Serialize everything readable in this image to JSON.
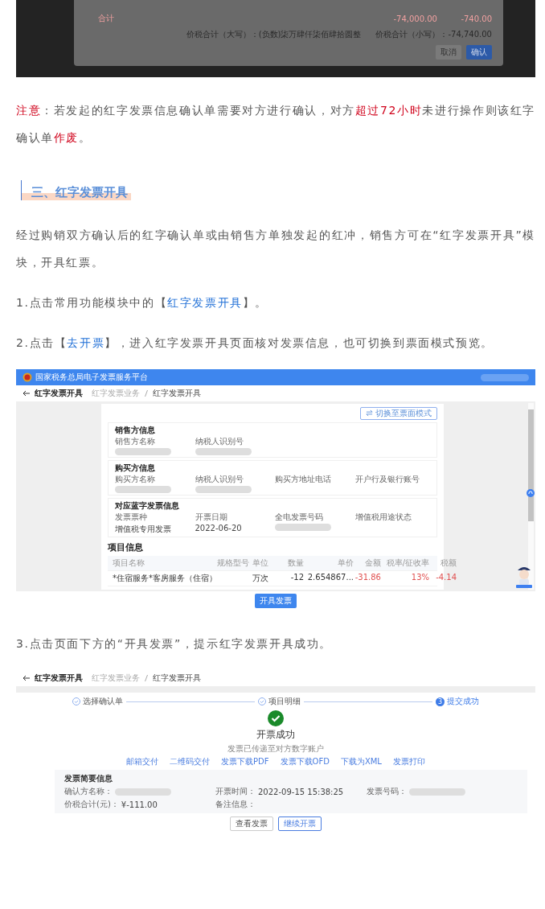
{
  "top_dialog": {
    "total_label": "合计",
    "total_amount": "-74,000.00",
    "total_tax": "-740.00",
    "sum_upper": "价税合计（大写）：(负数)柒万肆仟柒佰肆拾圆整",
    "sum_lower": "价税合计（小写）：-74,740.00",
    "buttons": [
      {
        "label": "取消",
        "primary": false
      },
      {
        "label": "确认",
        "primary": true
      }
    ]
  },
  "note": [
    {
      "text": "注意",
      "kind": "alert"
    },
    {
      "text": "：若发起的红字发票信息确认单需要对方进行确认，对方",
      "kind": "text"
    },
    {
      "text": "超过72小时",
      "kind": "alert"
    },
    {
      "text": "未进行操作则该红字确认单",
      "kind": "text"
    },
    {
      "text": "作废",
      "kind": "alert"
    },
    {
      "text": "。",
      "kind": "text"
    }
  ],
  "section_heading": "三、红字发票开具",
  "intro": "经过购销双方确认后的红字确认单或由销售方单独发起的红冲，销售方可在“红字发票开具”模块，开具红票。",
  "step_1": [
    {
      "text": "1.点击常用功能模块中的【",
      "kind": "text"
    },
    {
      "text": "红字发票开具",
      "kind": "link"
    },
    {
      "text": "】。",
      "kind": "text"
    }
  ],
  "step_2": [
    {
      "text": "2.点击【",
      "kind": "text"
    },
    {
      "text": "去开票",
      "kind": "link"
    },
    {
      "text": "】，进入红字发票开具页面核对发票信息，也可切换到票面模式预览。",
      "kind": "text"
    }
  ],
  "issue_screen": {
    "platform": "国家税务总局电子发票服务平台",
    "page_title": "红字发票开具",
    "breadcrumb": [
      "红字发票业务",
      "红字发票开具"
    ],
    "switch_button": "切换至票面模式",
    "sections": [
      {
        "title": "销售方信息",
        "fields": [
          {
            "label": "销售方名称",
            "blurred": true
          },
          {
            "label": "纳税人识别号",
            "blurred": true
          }
        ]
      },
      {
        "title": "购买方信息",
        "fields": [
          {
            "label": "购买方名称",
            "blurred": true
          },
          {
            "label": "纳税人识别号",
            "blurred": true
          },
          {
            "label": "购买方地址电话",
            "blurred": false
          },
          {
            "label": "开户行及银行账号",
            "blurred": false
          }
        ]
      },
      {
        "title": "对应蓝字发票信息",
        "fields": [
          {
            "label": "发票票种",
            "value": "增值税专用发票"
          },
          {
            "label": "开票日期",
            "value": "2022-06-20"
          },
          {
            "label": "全电发票号码",
            "blurred": true
          },
          {
            "label": "增值税用途状态",
            "blurred": false
          }
        ]
      }
    ],
    "items_title": "项目信息",
    "columns": [
      "项目名称",
      "规格型号",
      "单位",
      "数量",
      "单价",
      "金额",
      "税率/征收率",
      "税额"
    ],
    "rows": [
      [
        {
          "text": "*住宿服务*客房服务（住宿）",
          "negative": false
        },
        null,
        {
          "text": "万次",
          "negative": false
        },
        {
          "text": "-12",
          "negative": false
        },
        {
          "text": "2.654867...",
          "negative": false
        },
        {
          "text": "-31.86",
          "negative": true
        },
        {
          "text": "13%",
          "negative": true
        },
        {
          "text": "-4.14",
          "negative": true
        }
      ]
    ],
    "submit_button": "开具发票"
  },
  "step_3": "3.点击页面下方的“开具发票”，提示红字发票开具成功。",
  "success_screen": {
    "page_title": "红字发票开具",
    "breadcrumb": [
      "红字发票业务",
      "红字发票开具"
    ],
    "progress": [
      {
        "label": "选择确认单",
        "done": true
      },
      {
        "label": "项目明细",
        "done": true
      },
      {
        "label": "提交成功",
        "number": "3",
        "done": false
      }
    ],
    "title": "开票成功",
    "subtitle": "发票已传递至对方数字账户",
    "actions": [
      "邮箱交付",
      "二维码交付",
      "发票下载PDF",
      "发票下载OFD",
      "下载为XML",
      "发票打印"
    ],
    "summary": {
      "title": "发票简要信息",
      "fields": [
        {
          "label": "确认方名称：",
          "blurred": true
        },
        {
          "label": "开票时间：",
          "value": "2022-09-15 15:38:25"
        },
        {
          "label": "发票号码：",
          "blurred": true
        },
        {
          "label": "价税合计(元)：",
          "value": "¥-111.00"
        },
        {
          "label": "备注信息：",
          "blurred": false
        }
      ]
    },
    "buttons": [
      {
        "label": "查看发票",
        "primary": false
      },
      {
        "label": "继续开票",
        "primary": true
      }
    ]
  }
}
